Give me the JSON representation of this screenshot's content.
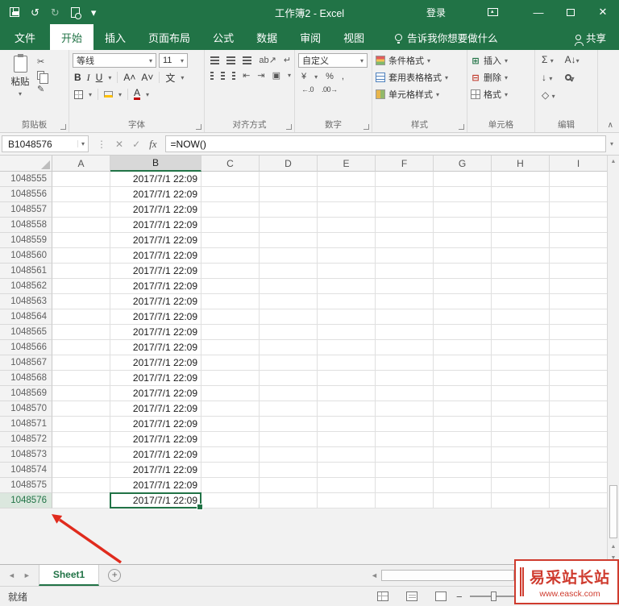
{
  "titlebar": {
    "title": "工作簿2 - Excel",
    "sign_in": "登录"
  },
  "tabs": {
    "file": "文件",
    "items": [
      "开始",
      "插入",
      "页面布局",
      "公式",
      "数据",
      "审阅",
      "视图"
    ],
    "active": "开始",
    "tell_me": "告诉我你想要做什么",
    "share": "共享"
  },
  "ribbon": {
    "paste": "粘贴",
    "font_name": "等线",
    "font_size": "11",
    "number_format": "自定义",
    "conditional_formatting": "条件格式",
    "format_as_table": "套用表格格式",
    "cell_styles": "单元格样式",
    "insert": "插入",
    "delete": "删除",
    "format": "格式",
    "groups": {
      "clipboard": "剪贴板",
      "font": "字体",
      "alignment": "对齐方式",
      "number": "数字",
      "styles": "样式",
      "cells": "单元格",
      "editing": "编辑"
    }
  },
  "formula_bar": {
    "name_box": "B1048576",
    "formula": "=NOW()"
  },
  "grid": {
    "columns": [
      "A",
      "B",
      "C",
      "D",
      "E",
      "F",
      "G",
      "H",
      "I"
    ],
    "selected_col": "B",
    "selected_row": "1048576",
    "rows": [
      {
        "n": "1048555",
        "b": "2017/7/1 22:09"
      },
      {
        "n": "1048556",
        "b": "2017/7/1 22:09"
      },
      {
        "n": "1048557",
        "b": "2017/7/1 22:09"
      },
      {
        "n": "1048558",
        "b": "2017/7/1 22:09"
      },
      {
        "n": "1048559",
        "b": "2017/7/1 22:09"
      },
      {
        "n": "1048560",
        "b": "2017/7/1 22:09"
      },
      {
        "n": "1048561",
        "b": "2017/7/1 22:09"
      },
      {
        "n": "1048562",
        "b": "2017/7/1 22:09"
      },
      {
        "n": "1048563",
        "b": "2017/7/1 22:09"
      },
      {
        "n": "1048564",
        "b": "2017/7/1 22:09"
      },
      {
        "n": "1048565",
        "b": "2017/7/1 22:09"
      },
      {
        "n": "1048566",
        "b": "2017/7/1 22:09"
      },
      {
        "n": "1048567",
        "b": "2017/7/1 22:09"
      },
      {
        "n": "1048568",
        "b": "2017/7/1 22:09"
      },
      {
        "n": "1048569",
        "b": "2017/7/1 22:09"
      },
      {
        "n": "1048570",
        "b": "2017/7/1 22:09"
      },
      {
        "n": "1048571",
        "b": "2017/7/1 22:09"
      },
      {
        "n": "1048572",
        "b": "2017/7/1 22:09"
      },
      {
        "n": "1048573",
        "b": "2017/7/1 22:09"
      },
      {
        "n": "1048574",
        "b": "2017/7/1 22:09"
      },
      {
        "n": "1048575",
        "b": "2017/7/1 22:09"
      },
      {
        "n": "1048576",
        "b": "2017/7/1 22:09"
      }
    ]
  },
  "sheet_bar": {
    "tabs": [
      "Sheet1"
    ],
    "active": "Sheet1"
  },
  "status_bar": {
    "ready": "就绪"
  },
  "watermark": {
    "title": "易采站长站",
    "url": "www.easck.com"
  },
  "colors": {
    "brand_green": "#217346",
    "arrow_red": "#e02b1d",
    "watermark_red": "#cf3b2e"
  }
}
